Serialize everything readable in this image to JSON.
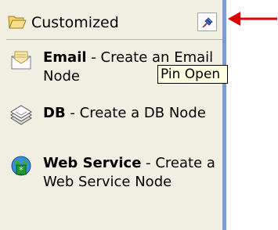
{
  "panel": {
    "title": "Customized",
    "pin_tooltip": "Pin Open",
    "folder_icon": "folder-open-icon",
    "pin_icon": "pushpin-icon",
    "border_color": "#7a9ccf",
    "panel_bg": "#f1efe2",
    "items": [
      {
        "name": "Email",
        "separator": " - ",
        "description": "Create an Email Node",
        "icon": "email-envelope-icon"
      },
      {
        "name": "DB",
        "separator": " - ",
        "description": "Create a DB Node",
        "icon": "database-icon"
      },
      {
        "name": "Web Service",
        "separator": " -",
        "description": "Create a Web Service Node",
        "icon": "globe-icon"
      }
    ]
  },
  "annotation": {
    "arrow_color": "#e00000",
    "arrow_icon": "red-arrow-icon"
  }
}
